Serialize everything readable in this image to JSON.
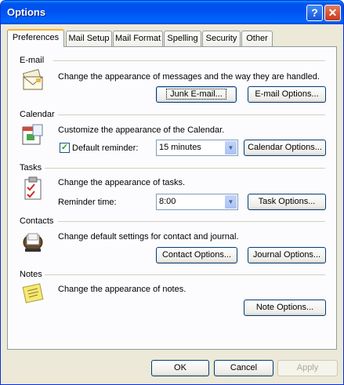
{
  "window": {
    "title": "Options"
  },
  "title_buttons": {
    "help": "?",
    "close": "✕"
  },
  "tabs": [
    {
      "label": "Preferences"
    },
    {
      "label": "Mail Setup"
    },
    {
      "label": "Mail Format"
    },
    {
      "label": "Spelling"
    },
    {
      "label": "Security"
    },
    {
      "label": "Other"
    }
  ],
  "sections": {
    "email": {
      "label": "E-mail",
      "description": "Change the appearance of messages and the way they are handled.",
      "junk_button": "Junk E-mail...",
      "options_button": "E-mail Options...",
      "icon": "envelope-icon"
    },
    "calendar": {
      "label": "Calendar",
      "description": "Customize the appearance of the Calendar.",
      "reminder_label": "Default reminder:",
      "reminder_checked": true,
      "reminder_value": "15 minutes",
      "options_button": "Calendar Options...",
      "icon": "calendar-icon"
    },
    "tasks": {
      "label": "Tasks",
      "description": "Change the appearance of tasks.",
      "reminder_label": "Reminder time:",
      "reminder_value": "8:00",
      "options_button": "Task Options...",
      "icon": "tasks-clipboard-icon"
    },
    "contacts": {
      "label": "Contacts",
      "description": "Change default settings for contact and journal.",
      "contact_button": "Contact Options...",
      "journal_button": "Journal Options...",
      "icon": "contacts-rolodex-icon"
    },
    "notes": {
      "label": "Notes",
      "description": "Change the appearance of notes.",
      "options_button": "Note Options...",
      "icon": "sticky-note-icon"
    }
  },
  "footer": {
    "ok": "OK",
    "cancel": "Cancel",
    "apply": "Apply"
  },
  "colors": {
    "titlebar": "#0053ee",
    "dialog_bg": "#ece9d8",
    "panel_bg": "#fcfcfe",
    "tab_highlight": "#f8b431"
  }
}
